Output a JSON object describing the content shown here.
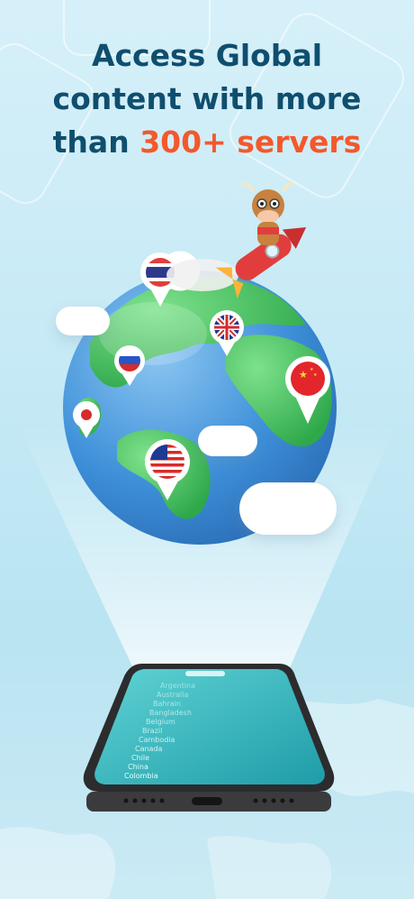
{
  "headline": {
    "line1": "Access Global",
    "line2": "content with more",
    "line3_prefix": "than ",
    "line3_accent": "300+ servers"
  },
  "colors": {
    "headline": "#0f4e6e",
    "accent": "#f4582b",
    "ocean": "#3d8fd8",
    "land": "#3cc35a",
    "phone_screen": "#2bb1b7"
  },
  "pins": [
    {
      "name": "thailand-flag-pin",
      "icon": "flag-thailand"
    },
    {
      "name": "uk-flag-pin",
      "icon": "flag-united-kingdom"
    },
    {
      "name": "russia-flag-pin",
      "icon": "flag-russia"
    },
    {
      "name": "china-flag-pin",
      "icon": "flag-china"
    },
    {
      "name": "japan-flag-pin",
      "icon": "flag-japan"
    },
    {
      "name": "usa-flag-pin",
      "icon": "flag-united-states"
    }
  ],
  "phone": {
    "countries": [
      "Argentina",
      "Australia",
      "Bahrain",
      "Bangladesh",
      "Belgium",
      "Brazil",
      "Cambodia",
      "Canada",
      "Chile",
      "China",
      "Colombia"
    ]
  },
  "mascot": {
    "icon": "cow-on-rocket"
  }
}
